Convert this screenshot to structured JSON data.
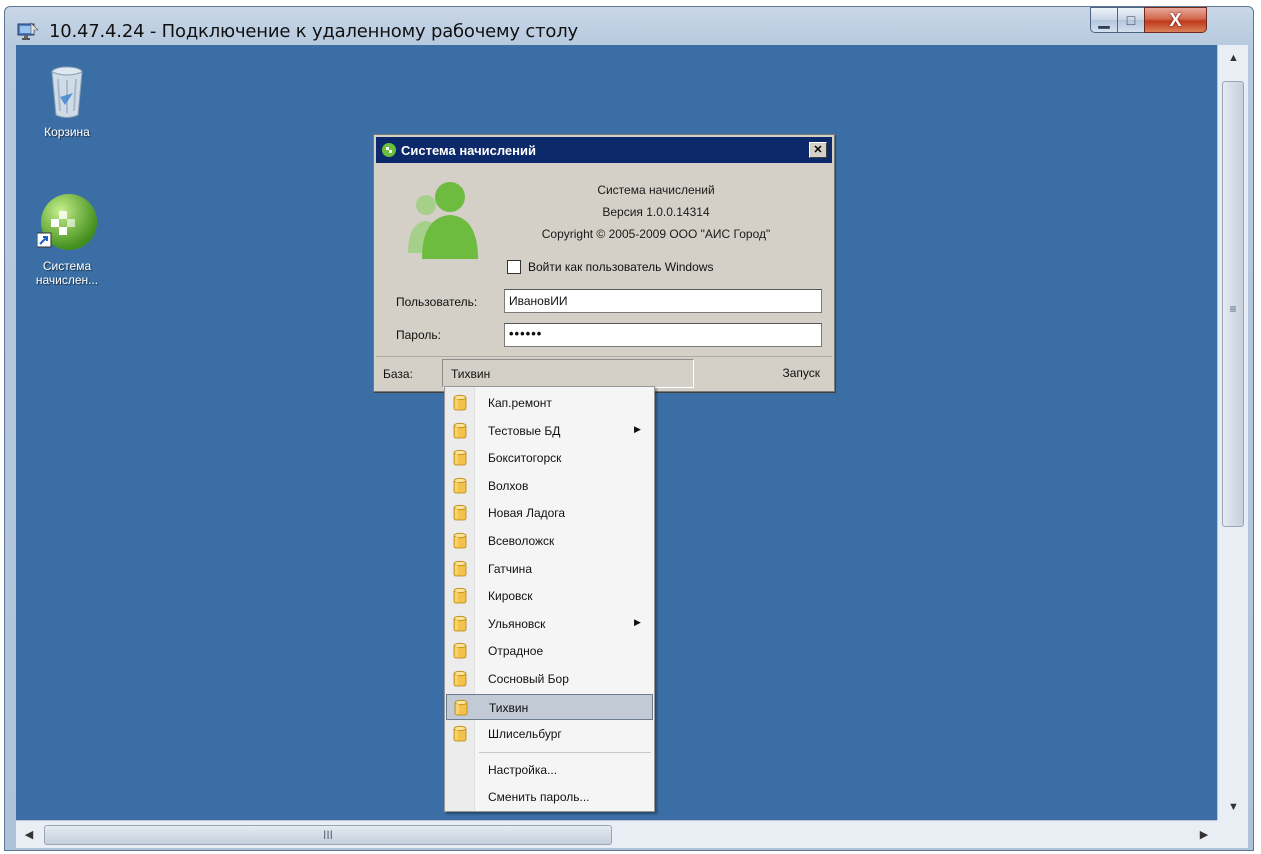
{
  "window": {
    "title": "10.47.4.24 - Подключение к удаленному рабочему столу",
    "min_glyph": "▁",
    "max_glyph": "□",
    "close_glyph": "X"
  },
  "desktop": {
    "background": "#3a6ea5",
    "icons": [
      {
        "label": "Корзина",
        "icon": "recycle-bin-icon"
      },
      {
        "label": "Система начислен...",
        "icon": "app-shortcut-icon"
      }
    ]
  },
  "dialog": {
    "title": "Система начислений",
    "close_glyph": "✕",
    "info": {
      "app_name": "Система начислений",
      "version": "Версия 1.0.0.14314",
      "copyright": "Copyright © 2005-2009 ООО \"АИС Город\""
    },
    "windows_login_label": "Войти как пользователь Windows",
    "windows_login_checked": false,
    "user_label": "Пользователь:",
    "user_value": "ИвановИИ",
    "password_label": "Пароль:",
    "password_value": "••••••",
    "base_label": "База:",
    "base_value": "Тихвин",
    "launch_label": "Запуск"
  },
  "menu": {
    "items": [
      {
        "label": "Кап.ремонт",
        "submenu": false,
        "selected": false
      },
      {
        "label": "Тестовые БД",
        "submenu": true,
        "selected": false
      },
      {
        "label": "Бокситогорск",
        "submenu": false,
        "selected": false
      },
      {
        "label": "Волхов",
        "submenu": false,
        "selected": false
      },
      {
        "label": "Новая Ладога",
        "submenu": false,
        "selected": false
      },
      {
        "label": "Всеволожск",
        "submenu": false,
        "selected": false
      },
      {
        "label": "Гатчина",
        "submenu": false,
        "selected": false
      },
      {
        "label": "Кировск",
        "submenu": false,
        "selected": false
      },
      {
        "label": "Ульяновск",
        "submenu": true,
        "selected": false
      },
      {
        "label": "Отрадное",
        "submenu": false,
        "selected": false
      },
      {
        "label": "Сосновый Бор",
        "submenu": false,
        "selected": false
      },
      {
        "label": "Тихвин",
        "submenu": false,
        "selected": true
      },
      {
        "label": "Шлисельбург",
        "submenu": false,
        "selected": false
      }
    ],
    "actions": [
      {
        "label": "Настройка..."
      },
      {
        "label": "Сменить пароль..."
      }
    ],
    "submenu_glyph": "▶"
  },
  "scrollbars": {
    "up_glyph": "▲",
    "down_glyph": "▼",
    "left_glyph": "◀",
    "right_glyph": "▶",
    "grip_v": "≡",
    "grip_h": "III"
  }
}
